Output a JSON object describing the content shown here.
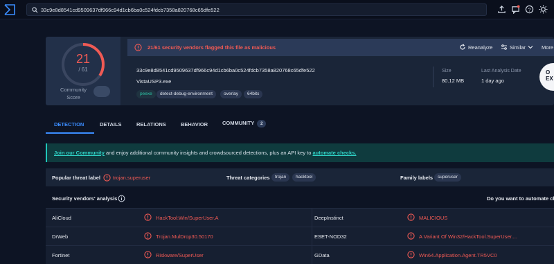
{
  "search": {
    "value": "33c9e8d8541cd9509637df966c94d1cb6ba0c524fdcb7358a820768c65dfe522"
  },
  "score": {
    "detected": "21",
    "total": "/ 61",
    "community_label_1": "Community",
    "community_label_2": "Score"
  },
  "alert": {
    "text": "21/61 security vendors flagged this file as malicious"
  },
  "actions": {
    "reanalyze": "Reanalyze",
    "similar": "Similar",
    "more": "More"
  },
  "file": {
    "hash": "33c9e8d8541cd9509637df966c94d1cb6ba0c524fdcb7358a820768c65dfe522",
    "name": "VistaUSP3.exe",
    "tags": [
      "peexe",
      "detect-debug-environment",
      "overlay",
      "64bits"
    ],
    "size_label": "Size",
    "size_value": "80.12 MB",
    "analysis_label": "Last Analysis Date",
    "analysis_value": "1 day ago",
    "type_line1": "O",
    "type_line2": "EX"
  },
  "tabs": {
    "detection": "DETECTION",
    "details": "DETAILS",
    "relations": "RELATIONS",
    "behavior": "BEHAVIOR",
    "community": "COMMUNITY",
    "community_count": "2"
  },
  "banner": {
    "link1": "Join our Community",
    "middle": " and enjoy additional community insights and crowdsourced detections, plus an API key to ",
    "link2": "automate checks."
  },
  "threat": {
    "popular_label": "Popular threat label",
    "popular_value": "trojan.superuser",
    "categories_label": "Threat categories",
    "categories": [
      "trojan",
      "hacktool"
    ],
    "family_label": "Family labels",
    "family": [
      "superuser"
    ]
  },
  "vendors": {
    "title": "Security vendors' analysis",
    "automate_prompt": "Do you want to automate ch",
    "rows": [
      {
        "left_name": "AliCloud",
        "left_result": "HackTool:Win/SuperUser.A",
        "right_name": "DeepInstinct",
        "right_result": "MALICIOUS"
      },
      {
        "left_name": "DrWeb",
        "left_result": "Trojan.MulDrop30.50170",
        "right_name": "ESET-NOD32",
        "right_result": "A Variant Of Win32/HackTool.SuperUser...."
      },
      {
        "left_name": "Fortinet",
        "left_result": "Riskware/SuperUser",
        "right_name": "GData",
        "right_result": "Win64.Application.Agent.TR5VC0"
      }
    ]
  },
  "colors": {
    "malicious": "#f05a54",
    "accent": "#3b8dff",
    "teal": "#1fc6ba",
    "bg": "#0d1424"
  },
  "icons": [
    "vt-logo-icon",
    "search-icon",
    "upload-icon",
    "chat-icon",
    "help-icon",
    "theme-icon",
    "alert-icon",
    "refresh-icon",
    "similar-icon",
    "chevron-down-icon",
    "info-icon"
  ]
}
